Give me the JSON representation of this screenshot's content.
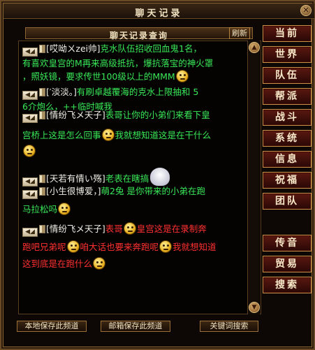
{
  "window": {
    "title": "聊天记录",
    "close_glyph": "✕"
  },
  "header": {
    "subtitle": "聊天记录查询",
    "refresh_label": "刷新"
  },
  "side_tabs": [
    "当前",
    "世界",
    "队伍",
    "帮派",
    "战斗",
    "系统",
    "信息",
    "祝福",
    "团队",
    "传音",
    "贸易",
    "搜索"
  ],
  "messages": [
    {
      "lines": [
        [
          "[哎呦ㄨzei帅]",
          "克水队伍招收回血鬼1名，"
        ],
        [
          "有喜欢皇宫的M再来高级抵抗，爆抗落宝的神火罩"
        ],
        [
          "，照妖镜，要求传世100级以上的MMM"
        ]
      ]
    },
    {
      "lines": [
        [
          "[′淡淡。]",
          "有刷卓越覆海的克水上限抽和 5"
        ],
        [
          "6介炮么，++临时喊我"
        ]
      ]
    },
    {
      "lines": [
        [
          "[情纷飞メ天子]",
          "表哥让你的小弟们来看下皇"
        ],
        [
          "宫桥上这是怎么回事",
          "我就想知道这是在干什么"
        ]
      ]
    },
    {
      "lines": [
        [
          "[天若有情い殇]",
          "老表在瞎搞"
        ]
      ]
    },
    {
      "lines": [
        [
          "[小生很博爱，]",
          "萌2兔 是你带来的小弟在跑"
        ],
        [
          "马拉松吗"
        ]
      ]
    },
    {
      "lines": [
        [
          "[情纷飞メ天子]",
          "表哥",
          "皇宫这是在录制奔"
        ],
        [
          "跑吧兄弟呢",
          "咱大话也要来奔跑呢",
          "我就想知道"
        ],
        [
          "这到底是在跑什么"
        ]
      ]
    }
  ],
  "footer": {
    "save_local": "本地保存此频道",
    "save_mail": "邮箱保存此频道",
    "keyword_search": "关键词搜索"
  },
  "icons": {
    "speaker": "speaker-icon",
    "flag": "flag-icon",
    "emoji": "smiley-emoji-icon",
    "ghost": "ghost-emoji-icon"
  },
  "colors": {
    "channel_text": "#38e858",
    "team_text": "#ff3030",
    "nav_bg": "#5a1810",
    "frame": "#8a6432"
  }
}
